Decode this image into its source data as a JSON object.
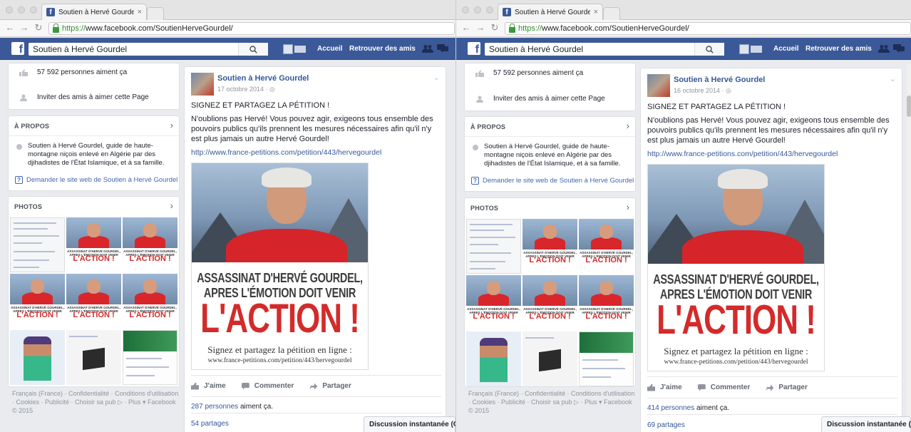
{
  "left": {
    "tab": {
      "title": "Soutien à Hervé Gourdel",
      "close": "×"
    },
    "url": {
      "scheme": "https://",
      "rest": "www.facebook.com/SoutienHerveGourdel/"
    },
    "fb": {
      "search_value": "Soutien à Hervé Gourdel",
      "home": "Accueil",
      "find_friends": "Retrouver des amis"
    },
    "sidebar": {
      "likes": "57 592 personnes aiment ça",
      "invite": "Inviter des amis à aimer cette Page",
      "about_title": "À PROPOS",
      "about_text": "Soutien à Hervé Gourdel, guide de haute-montagne niçois enlevé en Algérie par des djihadistes de l'État Islamique, et à sa famille.",
      "website": "Demander le site web de Soutien à Hervé Gourdel",
      "photos_title": "PHOTOS"
    },
    "footer": "Français (France) · Confidentialité · Conditions d'utilisation · Cookies · Publicité · Choisir sa pub ▷ · Plus ▾ Facebook © 2015",
    "post": {
      "page_name": "Soutien à Hervé Gourdel",
      "date": "17 octobre 2014 · ◎",
      "heading": "SIGNEZ ET PARTAGEZ LA PÉTITION !",
      "body": "N'oublions pas Hervé! Vous pouvez agir, exigeons tous ensemble des pouvoirs publics qu'ils prennent les mesures nécessaires afin qu'il n'y est plus jamais un autre Hervé Gourdel!",
      "link": "http://www.france-petitions.com/petition/443/hervegourdel",
      "poster": {
        "line1": "ASSASSINAT D'HERVÉ GOURDEL,",
        "line2": "APRES L'ÉMOTION DOIT VENIR",
        "action": "L'ACTION !",
        "sign": "Signez et partagez la pétition en ligne :",
        "url": "www.france-petitions.com/petition/443/hervegourdel"
      },
      "like": "J'aime",
      "comment": "Commenter",
      "share": "Partager",
      "likes_count": "287 personnes",
      "likes_suffix": " aiment ça.",
      "shares": "54 partages"
    },
    "chat": "Discussion instantanée (Off)"
  },
  "right": {
    "tab": {
      "title": "Soutien à Hervé Gourdel",
      "close": "×"
    },
    "url": {
      "scheme": "https://",
      "rest": "www.facebook.com/SoutienHerveGourdel/"
    },
    "fb": {
      "search_value": "Soutien à Hervé Gourdel",
      "home": "Accueil",
      "find_friends": "Retrouver des amis"
    },
    "sidebar": {
      "likes": "57 592 personnes aiment ça",
      "invite": "Inviter des amis à aimer cette Page",
      "about_title": "À PROPOS",
      "about_text": "Soutien à Hervé Gourdel, guide de haute-montagne niçois enlevé en Algérie par des djihadistes de l'État Islamique, et à sa famille.",
      "website": "Demander le site web de Soutien à Hervé Gourdel",
      "photos_title": "PHOTOS"
    },
    "footer": "Français (France) · Confidentialité · Conditions d'utilisation · Cookies · Publicité · Choisir sa pub ▷ · Plus ▾ Facebook © 2015",
    "post": {
      "page_name": "Soutien à Hervé Gourdel",
      "date": "16 octobre 2014 · ◎",
      "heading": "SIGNEZ ET PARTAGEZ LA PÉTITION !",
      "body": "N'oublions pas Hervé! Vous pouvez agir, exigeons tous ensemble des pouvoirs publics qu'ils prennent les mesures nécessaires afin qu'il n'y est plus jamais un autre Hervé Gourdel!",
      "link": "http://www.france-petitions.com/petition/443/hervegourdel",
      "poster": {
        "line1": "ASSASSINAT D'HERVÉ GOURDEL,",
        "line2": "APRES L'ÉMOTION DOIT VENIR",
        "action": "L'ACTION !",
        "sign": "Signez et partagez la pétition en ligne :",
        "url": "www.france-petitions.com/petition/443/hervegourdel"
      },
      "like": "J'aime",
      "comment": "Commenter",
      "share": "Partager",
      "likes_count": "414 personnes",
      "likes_suffix": " aiment ça.",
      "shares": "69 partages"
    },
    "chat": "Discussion instantanée (Off)"
  },
  "photo_tiles": {
    "poster_sub": "ASSASSINAT D'HERVÉ GOURDEL, APRES L'ÉMOTION DOIT VENIR",
    "poster_action": "L'ACTION !"
  },
  "icons": {
    "back": "back-arrow-icon",
    "forward": "forward-arrow-icon",
    "reload": "reload-icon",
    "lock": "lock-icon",
    "search": "search-icon",
    "friends": "friend-requests-icon",
    "messages": "messages-icon",
    "likes_row": "thumbs-up-icon",
    "invite_row": "person-icon",
    "chevron": "chevron-right-icon"
  },
  "colors": {
    "fb_blue": "#3b5998",
    "link": "#365899",
    "action_red": "#d32b2b"
  }
}
